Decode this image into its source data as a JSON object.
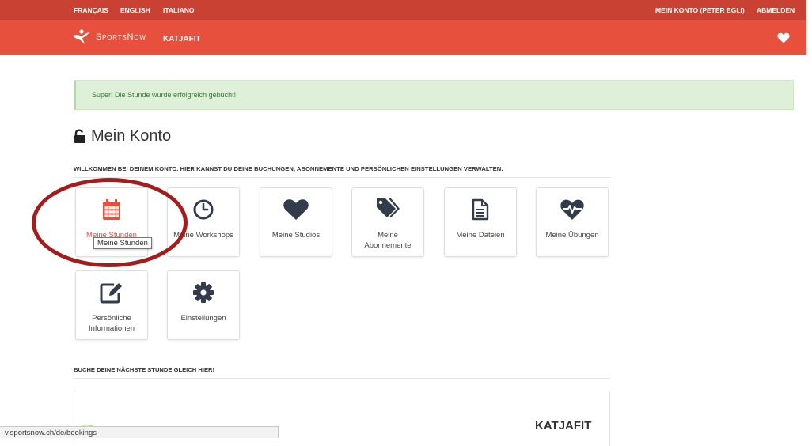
{
  "topbar": {
    "languages": [
      "FRANÇAIS",
      "ENGLISH",
      "ITALIANO"
    ],
    "account_label": "MEIN KONTO (PETER EGLI)",
    "logout_label": "ABMELDEN"
  },
  "navbar": {
    "brand": "SportsNow",
    "studio": "KATJAFIT",
    "heart_icon": "heart-icon"
  },
  "alert": {
    "message": "Super! Die Stunde wurde erfolgreich gebucht!"
  },
  "page": {
    "title": "Mein Konto",
    "title_icon": "unlock-icon",
    "welcome": "WILLKOMMEN BEI DEINEM KONTO. HIER KANNST DU DEINE BUCHUNGEN, ABONNEMENTE UND PERSÖNLICHEN EINSTELLUNGEN VERWALTEN."
  },
  "tiles": [
    {
      "label": "Meine Stunden",
      "icon": "calendar-icon"
    },
    {
      "label": "Meine Workshops",
      "icon": "clock-icon"
    },
    {
      "label": "Meine Studios",
      "icon": "heart-icon"
    },
    {
      "label": "Meine Abonnemente",
      "icon": "tags-icon"
    },
    {
      "label": "Meine Dateien",
      "icon": "file-icon"
    },
    {
      "label": "Meine Übungen",
      "icon": "heartbeat-icon"
    },
    {
      "label": "Persönliche Informationen",
      "icon": "edit-icon"
    },
    {
      "label": "Einstellungen",
      "icon": "gear-icon"
    }
  ],
  "tooltip": "Meine Stunden",
  "booking": {
    "heading": "BUCHE DEINE NÄCHSTE STUNDE GLEICH HIER!",
    "studio_name": "KATJAFIT"
  },
  "statusbar": {
    "url": "v.sportsnow.ch/de/bookings"
  },
  "colors": {
    "topbar": "#c94133",
    "navbar": "#e8503e",
    "accent": "#e8503e",
    "icon": "#333c4a",
    "alert_bg": "#dff0d8",
    "annotation": "#a31d1d"
  }
}
